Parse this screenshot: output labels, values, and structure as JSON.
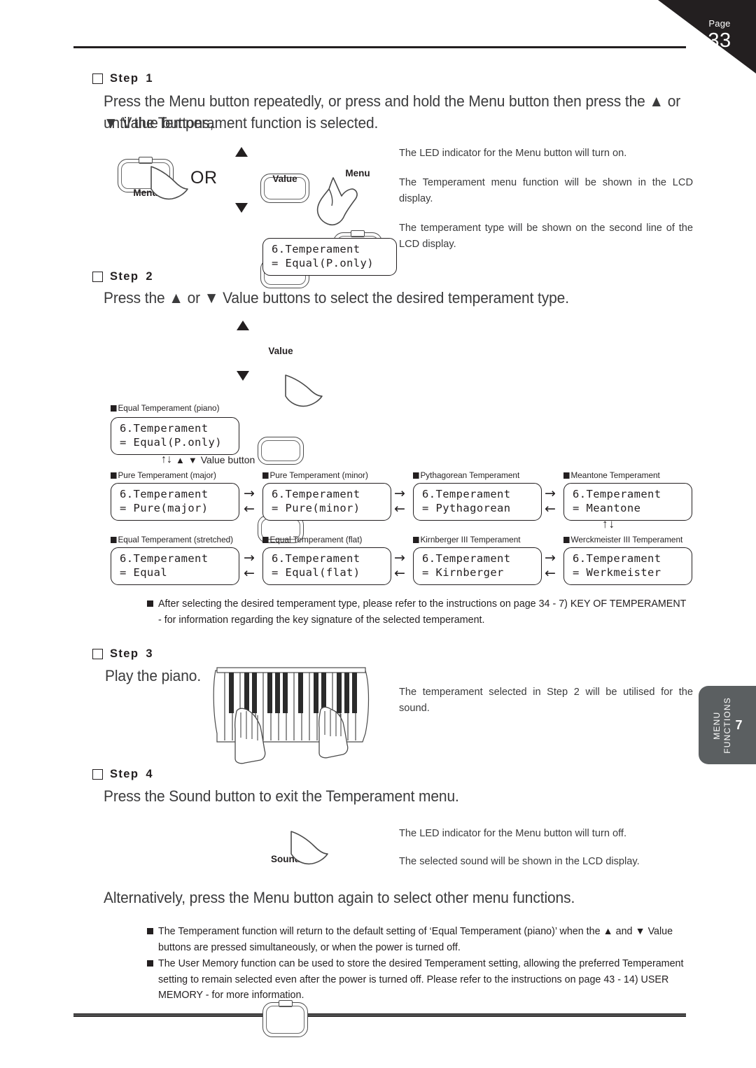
{
  "page": {
    "label": "Page",
    "number": "33"
  },
  "side_tab": {
    "line1": "MENU",
    "line2": "FUNCTIONS",
    "number": "7"
  },
  "steps": {
    "step1": {
      "label": "Step",
      "number": "1",
      "line1": "Press the Menu button repeatedly, or press and hold the Menu button then press the ▲ or ▼ Value buttons,",
      "line2": "until the Temperament function is selected.",
      "notes": [
        "The LED indicator for the Menu button will turn on.",
        "The Temperament menu function will be shown in the LCD display.",
        "The temperament type will be shown on the second line of the LCD display."
      ],
      "buttons": {
        "menu_left": "Menu",
        "or": "OR",
        "value": "Value",
        "menu_right": "Menu"
      },
      "lcd": {
        "line1": "6.Temperament",
        "line2": "= Equal(P.only)"
      }
    },
    "step2": {
      "label": "Step",
      "number": "2",
      "line1": "Press the ▲ or ▼ Value buttons to select the desired temperament type.",
      "value_button_label": "Value",
      "value_button_caption": "Value button",
      "value_button_arrows": "↑↓",
      "default_caption": "Equal Temperament (piano)",
      "default_lcd": {
        "line1": "6.Temperament",
        "line2": "= Equal(P.only)"
      },
      "grid": [
        [
          {
            "caption": "Pure Temperament (major)",
            "line1": "6.Temperament",
            "line2": "= Pure(major)"
          },
          {
            "caption": "Pure Temperament (minor)",
            "line1": "6.Temperament",
            "line2": "= Pure(minor)"
          },
          {
            "caption": "Pythagorean Temperament",
            "line1": "6.Temperament",
            "line2": "= Pythagorean"
          },
          {
            "caption": "Meantone Temperament",
            "line1": "6.Temperament",
            "line2": "= Meantone"
          }
        ],
        [
          {
            "caption": "Equal Temperament (stretched)",
            "line1": "6.Temperament",
            "line2": "= Equal"
          },
          {
            "caption": "Equal Temperament (flat)",
            "line1": "6.Temperament",
            "line2": "= Equal(flat)"
          },
          {
            "caption": "Kirnberger III Temperament",
            "line1": "6.Temperament",
            "line2": "= Kirnberger"
          },
          {
            "caption": "Werckmeister III Temperament",
            "line1": "6.Temperament",
            "line2": "= Werkmeister"
          }
        ]
      ],
      "wrap_arrows": "↑↓",
      "forward_arrow": "→",
      "back_arrow": "←",
      "footnote_line1": "After selecting the desired temperament type, please refer to the instructions on page 34 - 7) KEY OF TEMPERAMENT",
      "footnote_line2": "- for information regarding the key signature of the selected temperament."
    },
    "step3": {
      "label": "Step",
      "number": "3",
      "line1": "Play the piano.",
      "note": "The temperament selected in Step 2 will be utilised for the sound."
    },
    "step4": {
      "label": "Step",
      "number": "4",
      "line1": "Press the Sound button to exit the Temperament menu.",
      "button_caption": "Sound",
      "notes": [
        "The LED indicator for the Menu button will turn off.",
        "The selected sound will be shown in the LCD display."
      ],
      "alternative": "Alternatively, press the Menu button again to select other menu functions."
    }
  },
  "bottom_notes": [
    "The Temperament function will return to the default setting of ‘Equal Temperament (piano)’ when the ▲ and ▼ Value buttons are pressed simultaneously, or when the power is turned off.",
    "The User Memory function can be used to store the desired Temperament setting, allowing the preferred Temperament setting to remain selected even after the power is turned off.  Please refer to the instructions on page 43 - 14) USER MEMORY - for more information."
  ]
}
